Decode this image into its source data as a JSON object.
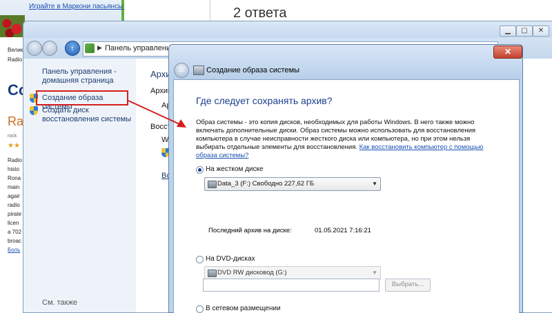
{
  "background_page": {
    "top_link_1": "",
    "top_link_2": "Играйте в Маркони пасьянсы он",
    "answers_title": "2 ответа",
    "left_fragments": {
      "f1": "Велико",
      "f2": "Radio",
      "f3": "Co",
      "f4": "Ra",
      "f5": "rock",
      "f6": "Radio",
      "f7": "histo",
      "f8": "Rona",
      "f9": "main",
      "f10": "agair",
      "f11": "radio",
      "f12": "pirate",
      "f13": "licen",
      "f14": "a 702",
      "f15": "broac",
      "f16": "Боль"
    }
  },
  "control_panel": {
    "address_path": "Панель управления",
    "sidebar": {
      "home_link": "Панель управления - домашняя страница",
      "create_image_link": "Создание образа системы",
      "create_repair_disk_link": "Создать диск восстановления системы",
      "see_also": "См. также"
    },
    "main_fragments": {
      "m1": "Архи",
      "m2": "Архив",
      "m3": "Ар",
      "m4": "Восста",
      "m5": "Wi",
      "m6": "Во"
    }
  },
  "dialog": {
    "title": "Создание образа системы",
    "heading": "Где следует сохранять архив?",
    "description": "Образ системы - это копия дисков, необходимых для работы Windows. В него также можно включать дополнительные диски. Образ системы можно использовать для восстановления компьютера в случае неисправности жесткого диска или компьютера, но при этом нельзя выбирать отдельные элементы для восстановления.",
    "help_link": "Как восстановить компьютер с помощью образа системы?",
    "options": {
      "hard_disk": {
        "label": "На жестком диске",
        "selected": true,
        "drive_value": "Data_3 (F:)  Свободно 227,62 ГБ",
        "last_archive_label": "Последний архив на диске:",
        "last_archive_value": "01.05.2021 7:16:21"
      },
      "dvd": {
        "label": "На DVD-дисках",
        "selected": false,
        "drive_value": "DVD RW дисковод (G:)"
      },
      "network": {
        "label": "В сетевом размещении",
        "selected": false,
        "path_value": "",
        "browse_label": "Выбрать..."
      }
    },
    "close_glyph": "✕"
  },
  "colors": {
    "highlight": "#d41d1d",
    "link": "#1a52b4",
    "heading": "#1a3e8c"
  }
}
